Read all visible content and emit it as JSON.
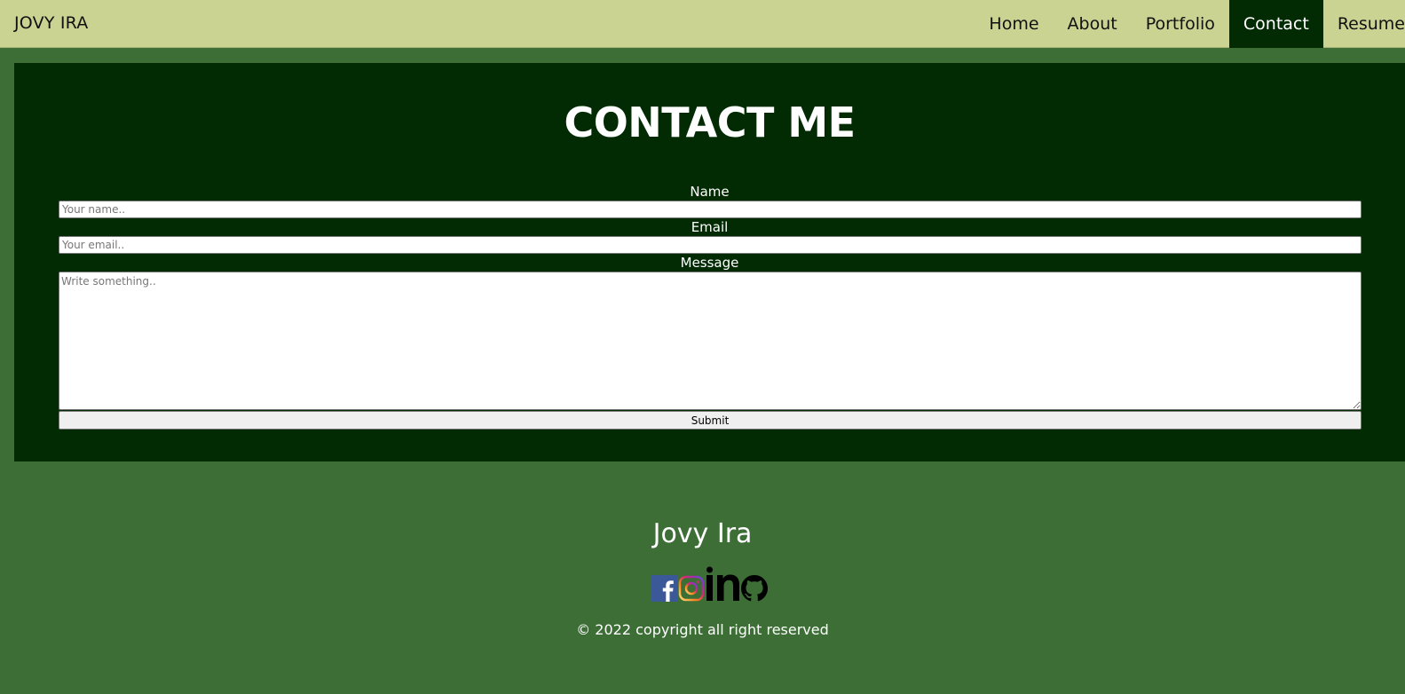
{
  "nav": {
    "brand": "JOVY IRA",
    "links": [
      {
        "label": "Home",
        "active": false
      },
      {
        "label": "About",
        "active": false
      },
      {
        "label": "Portfolio",
        "active": false
      },
      {
        "label": "Contact",
        "active": true
      },
      {
        "label": "Resume",
        "active": false
      }
    ]
  },
  "contact": {
    "title": "CONTACT ME",
    "name_label": "Name",
    "name_placeholder": "Your name..",
    "email_label": "Email",
    "email_placeholder": "Your email..",
    "message_label": "Message",
    "message_placeholder": "Write something..",
    "submit_label": "Submit"
  },
  "footer": {
    "name": "Jovy Ira",
    "socials": [
      "facebook-icon",
      "instagram-icon",
      "linkedin-icon",
      "github-icon"
    ],
    "copyright": "© 2022 copyright all right reserved"
  },
  "colors": {
    "navbar_bg": "#cbd393",
    "page_bg": "#3c6e35",
    "section_bg": "#022b04",
    "active_nav_bg": "#022b04"
  }
}
